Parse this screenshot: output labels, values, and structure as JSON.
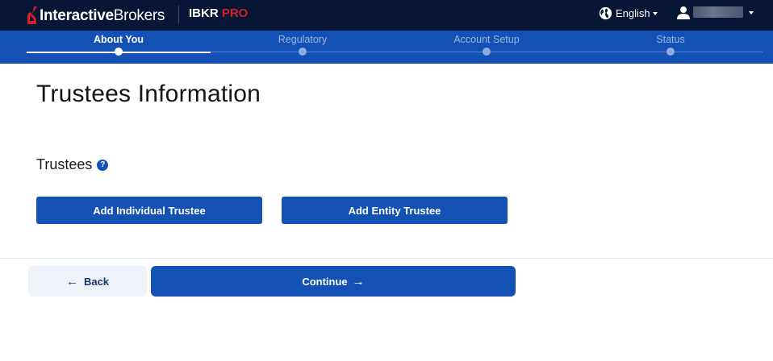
{
  "header": {
    "brand_bold": "Interactive",
    "brand_light": "Brokers",
    "product_main": "IBKR",
    "product_accent": "PRO",
    "language": "English",
    "logo_icon": "ib-logo-icon",
    "language_icon": "globe-icon",
    "user_icon": "user-icon"
  },
  "stepper": {
    "steps": [
      {
        "label": "About You",
        "state": "active"
      },
      {
        "label": "Regulatory",
        "state": "pending"
      },
      {
        "label": "Account Setup",
        "state": "pending"
      },
      {
        "label": "Status",
        "state": "pending"
      }
    ]
  },
  "main": {
    "title": "Trustees Information",
    "section_title": "Trustees",
    "help_icon": "question-icon",
    "help_glyph": "?",
    "add_individual": "Add Individual Trustee",
    "add_entity": "Add Entity Trustee"
  },
  "footer": {
    "back_label": "Back",
    "back_icon": "arrow-left-icon",
    "continue_label": "Continue",
    "continue_icon": "arrow-right-icon"
  },
  "colors": {
    "topbar": "#061634",
    "primary": "#1451b5",
    "pro_accent": "#d81e2a",
    "back_bg": "#eef2f9"
  }
}
